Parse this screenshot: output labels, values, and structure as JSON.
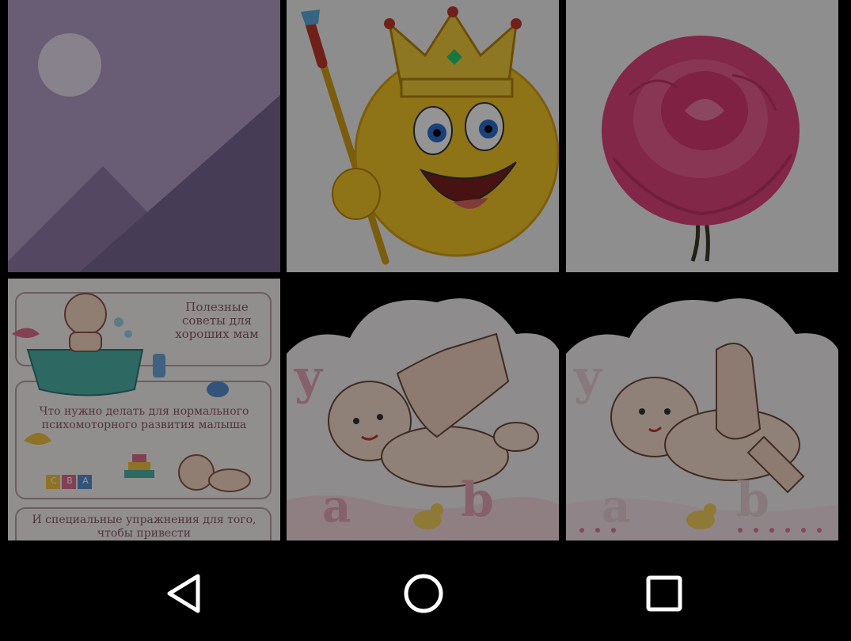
{
  "gallery": {
    "tiles": [
      {
        "name": "placeholder-image"
      },
      {
        "name": "king-smiley-image"
      },
      {
        "name": "pink-rose-image"
      },
      {
        "name": "baby-tips-card-image",
        "heading": "Полезные советы для хороших мам",
        "middle_text": "Что нужно делать для нормального психомоторного развития малыша",
        "bottom_text": "И специальные упражнения для того, чтобы привести",
        "blocks": [
          "C",
          "B",
          "A"
        ]
      },
      {
        "name": "baby-massage-image-1",
        "letters": [
          "y",
          "a",
          "b"
        ]
      },
      {
        "name": "baby-massage-image-2",
        "letters": [
          "y",
          "a",
          "b"
        ]
      }
    ]
  },
  "navbar": {
    "back": "back-icon",
    "home": "home-icon",
    "recents": "recents-icon"
  }
}
